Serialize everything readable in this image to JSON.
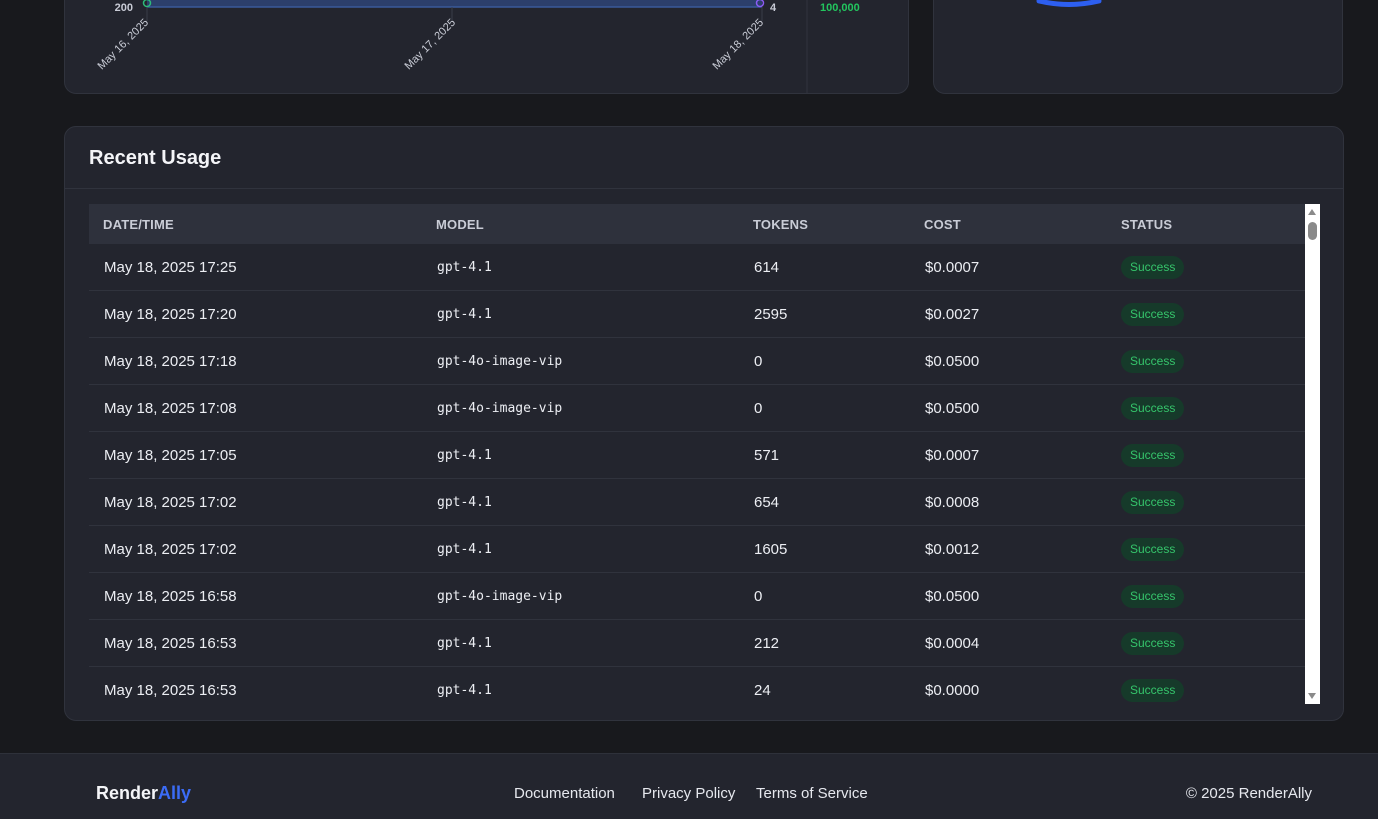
{
  "chart": {
    "x_ticks": [
      "May 16, 2025",
      "May 17, 2025",
      "May 18, 2025"
    ],
    "left_axis_tick": "200",
    "right_axis_tick": "4",
    "right_value": "100,000",
    "colors": {
      "area": "#2c3f6b",
      "left_point": "#2dbb7a",
      "right_point": "#8b5cf6",
      "value": "#22c55e"
    }
  },
  "donut": {
    "color": "#2d5ff0"
  },
  "usage": {
    "title": "Recent Usage",
    "columns": [
      "DATE/TIME",
      "MODEL",
      "TOKENS",
      "COST",
      "STATUS"
    ],
    "rows": [
      {
        "datetime": "May 18, 2025 17:25",
        "model": "gpt-4.1",
        "tokens": "614",
        "cost": "$0.0007",
        "status": "Success"
      },
      {
        "datetime": "May 18, 2025 17:20",
        "model": "gpt-4.1",
        "tokens": "2595",
        "cost": "$0.0027",
        "status": "Success"
      },
      {
        "datetime": "May 18, 2025 17:18",
        "model": "gpt-4o-image-vip",
        "tokens": "0",
        "cost": "$0.0500",
        "status": "Success"
      },
      {
        "datetime": "May 18, 2025 17:08",
        "model": "gpt-4o-image-vip",
        "tokens": "0",
        "cost": "$0.0500",
        "status": "Success"
      },
      {
        "datetime": "May 18, 2025 17:05",
        "model": "gpt-4.1",
        "tokens": "571",
        "cost": "$0.0007",
        "status": "Success"
      },
      {
        "datetime": "May 18, 2025 17:02",
        "model": "gpt-4.1",
        "tokens": "654",
        "cost": "$0.0008",
        "status": "Success"
      },
      {
        "datetime": "May 18, 2025 17:02",
        "model": "gpt-4.1",
        "tokens": "1605",
        "cost": "$0.0012",
        "status": "Success"
      },
      {
        "datetime": "May 18, 2025 16:58",
        "model": "gpt-4o-image-vip",
        "tokens": "0",
        "cost": "$0.0500",
        "status": "Success"
      },
      {
        "datetime": "May 18, 2025 16:53",
        "model": "gpt-4.1",
        "tokens": "212",
        "cost": "$0.0004",
        "status": "Success"
      },
      {
        "datetime": "May 18, 2025 16:53",
        "model": "gpt-4.1",
        "tokens": "24",
        "cost": "$0.0000",
        "status": "Success"
      }
    ]
  },
  "footer": {
    "brand_main": "Render",
    "brand_accent": "Ally",
    "links": [
      "Documentation",
      "Privacy Policy",
      "Terms of Service"
    ],
    "copyright": "© 2025 RenderAlly"
  }
}
